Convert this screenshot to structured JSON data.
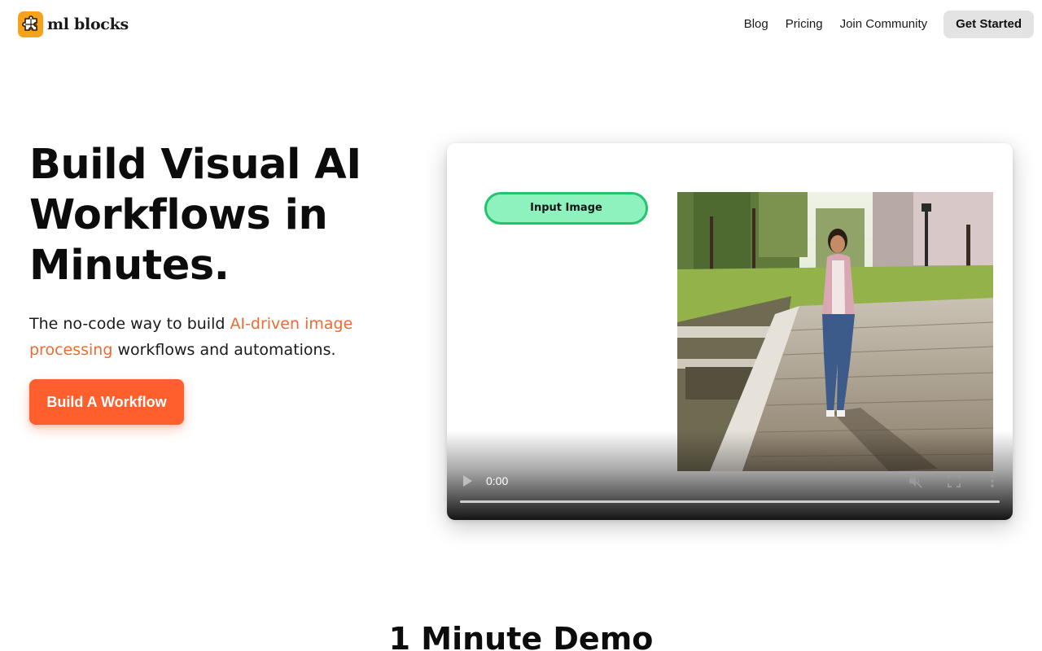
{
  "nav": {
    "brand": "ml blocks",
    "links": [
      {
        "label": "Blog"
      },
      {
        "label": "Pricing"
      },
      {
        "label": "Join Community"
      }
    ],
    "cta": "Get Started"
  },
  "hero": {
    "title": "Build Visual AI Workflows in Minutes.",
    "subtitle_before": "The no-code way to build ",
    "subtitle_highlight": "AI-driven image processing",
    "subtitle_after": " workflows and automations.",
    "button": "Build A Workflow"
  },
  "video": {
    "node_label": "Input Image",
    "time": "0:00",
    "progress": 0,
    "photo_description_icon": "image"
  },
  "demo": {
    "title": "1 Minute Demo"
  },
  "colors": {
    "accent": "#ff5e2d",
    "highlight_text": "#ee6a33",
    "logo": "#f7a21b",
    "node_fill": "#8ef2bf",
    "node_border": "#24c46c"
  }
}
